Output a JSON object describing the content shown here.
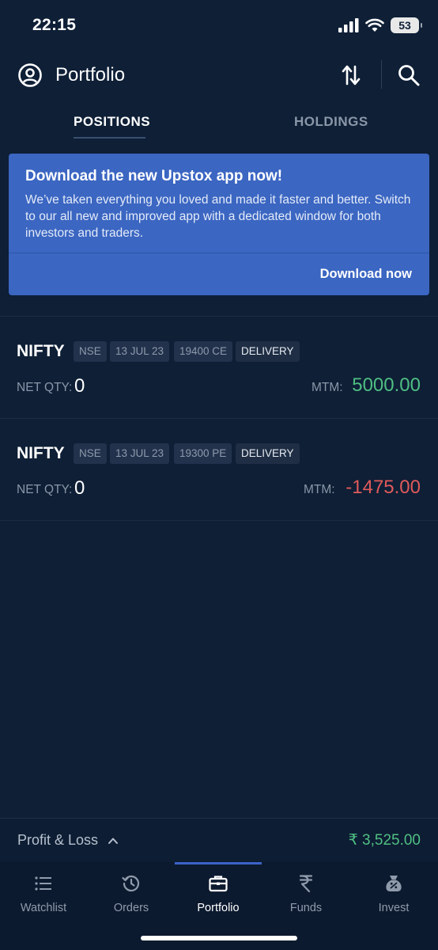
{
  "status_bar": {
    "time": "22:15",
    "battery": "53"
  },
  "header": {
    "title": "Portfolio"
  },
  "tabs": [
    {
      "label": "POSITIONS",
      "active": true
    },
    {
      "label": "HOLDINGS",
      "active": false
    }
  ],
  "banner": {
    "title": "Download the new Upstox app now!",
    "text": "We’ve taken everything you loved and made it faster and better. Switch to our all new and improved app with a dedicated window for both investors and traders.",
    "button": "Download now"
  },
  "positions": [
    {
      "symbol": "NIFTY",
      "exchange": "NSE",
      "expiry": "13 JUL 23",
      "strike": "19400 CE",
      "product": "DELIVERY",
      "net_qty_label": "NET QTY:",
      "net_qty": "0",
      "mtm_label": "MTM:",
      "mtm": "5000.00"
    },
    {
      "symbol": "NIFTY",
      "exchange": "NSE",
      "expiry": "13 JUL 23",
      "strike": "19300 PE",
      "product": "DELIVERY",
      "net_qty_label": "NET QTY:",
      "net_qty": "0",
      "mtm_label": "MTM:",
      "mtm": "-1475.00"
    }
  ],
  "pnl": {
    "label": "Profit & Loss",
    "value": "₹ 3,525.00"
  },
  "nav": [
    {
      "label": "Watchlist",
      "icon": "list-icon"
    },
    {
      "label": "Orders",
      "icon": "history-icon"
    },
    {
      "label": "Portfolio",
      "icon": "briefcase-icon",
      "active": true
    },
    {
      "label": "Funds",
      "icon": "rupee-icon"
    },
    {
      "label": "Invest",
      "icon": "money-bag-icon"
    }
  ],
  "colors": {
    "background": "#0e1f36",
    "banner": "#3b66c2",
    "positive": "#4fbf83",
    "negative": "#e05a5a",
    "accent": "#3c63c8"
  }
}
